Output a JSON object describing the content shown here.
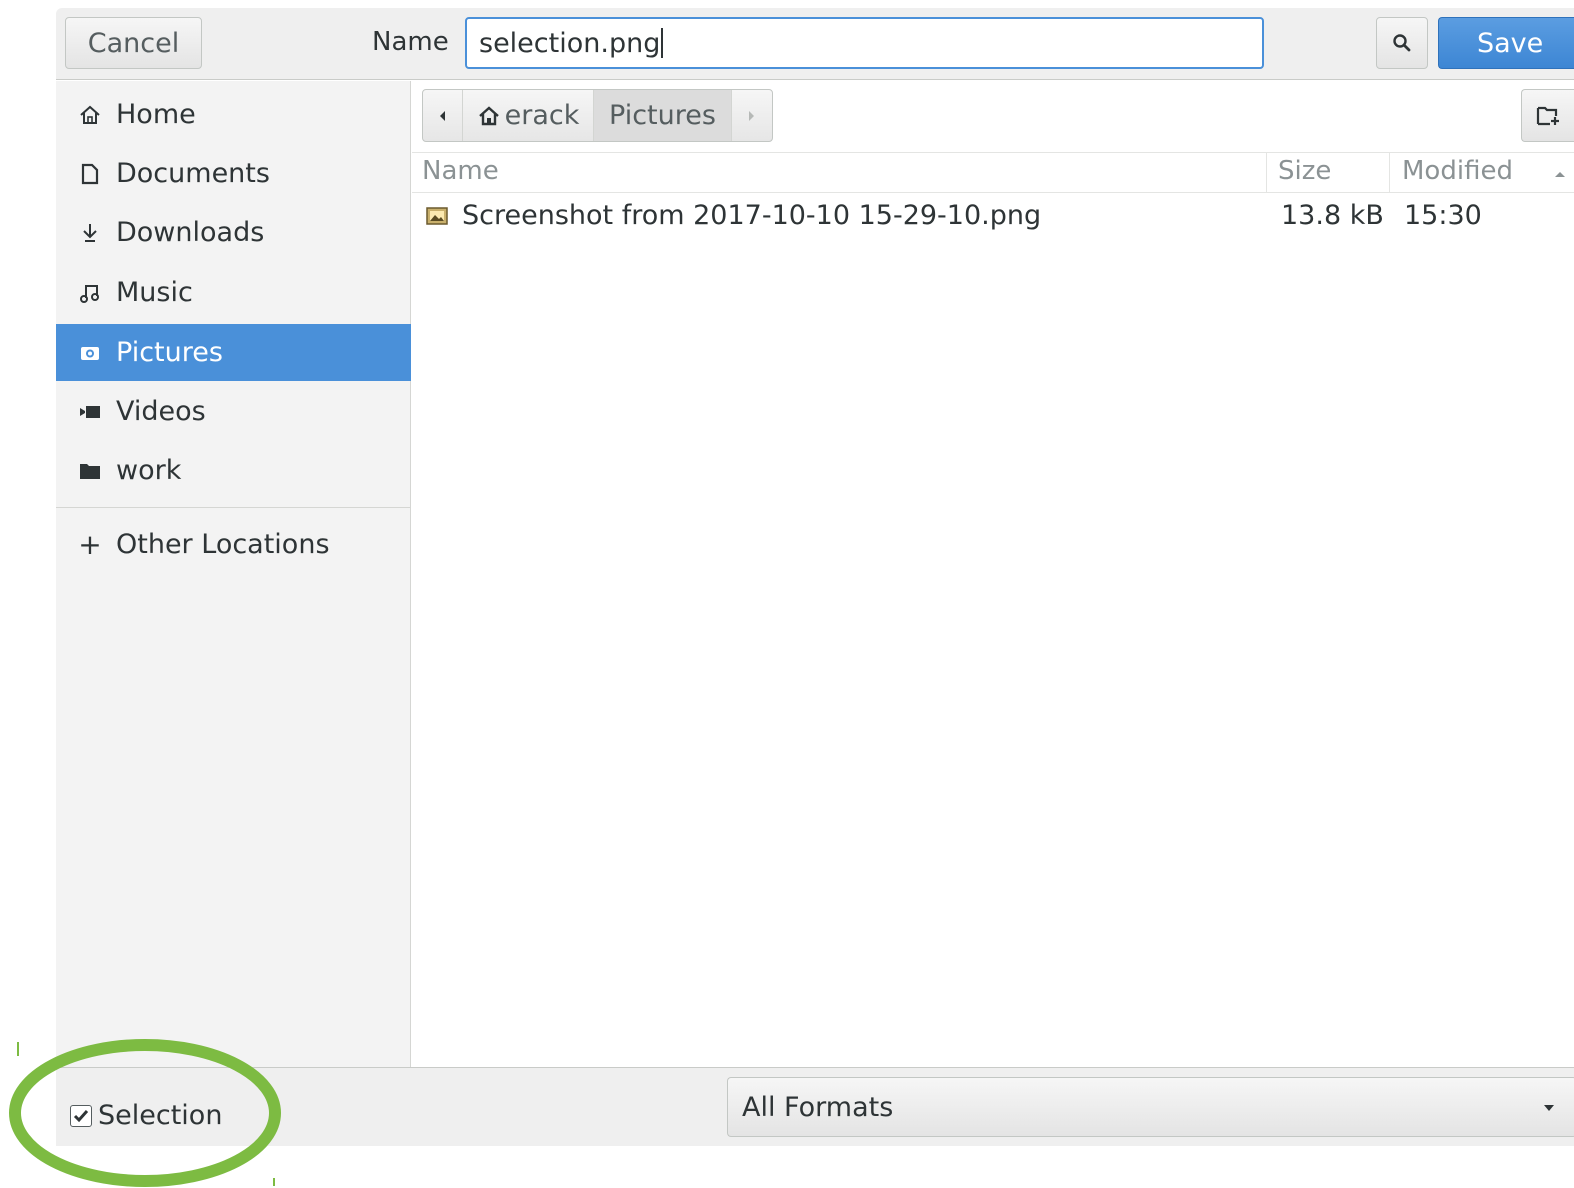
{
  "header": {
    "cancel_label": "Cancel",
    "name_label": "Name",
    "filename_value": "selection.png",
    "save_label": "Save"
  },
  "sidebar": {
    "items": [
      {
        "label": "Home",
        "icon": "home-icon",
        "active": false
      },
      {
        "label": "Documents",
        "icon": "document-icon",
        "active": false
      },
      {
        "label": "Downloads",
        "icon": "download-icon",
        "active": false
      },
      {
        "label": "Music",
        "icon": "music-icon",
        "active": false
      },
      {
        "label": "Pictures",
        "icon": "camera-icon",
        "active": true
      },
      {
        "label": "Videos",
        "icon": "video-icon",
        "active": false
      },
      {
        "label": "work",
        "icon": "folder-icon",
        "active": false
      }
    ],
    "other_locations_label": "Other Locations"
  },
  "pathbar": {
    "segments": [
      "erack",
      "Pictures"
    ]
  },
  "file_list": {
    "columns": [
      "Name",
      "Size",
      "Modified"
    ],
    "sort_column": "Modified",
    "rows": [
      {
        "name": "Screenshot from 2017-10-10 15-29-10.png",
        "size": "13.8 kB",
        "modified": "15:30",
        "icon": "image-file-icon"
      }
    ]
  },
  "footer": {
    "selection_label": "Selection",
    "selection_checked": true,
    "format_value": "All Formats"
  },
  "colors": {
    "accent": "#4a90d9",
    "annotation_circle": "#7dbb42",
    "sidebar_bg": "#f3f3f3"
  }
}
